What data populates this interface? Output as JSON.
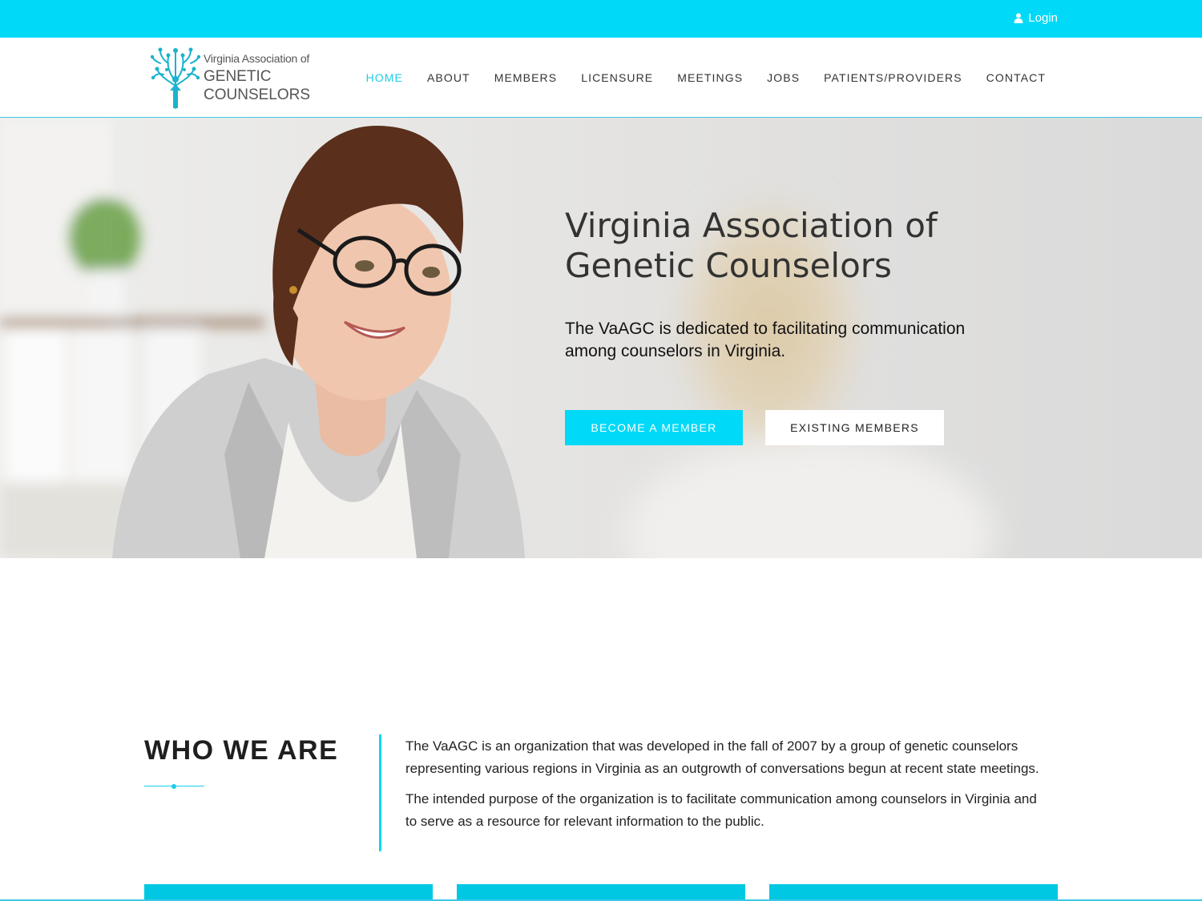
{
  "topbar": {
    "login_label": "Login",
    "accent_color": "#00d9f7"
  },
  "logo": {
    "line1": "Virginia Association of",
    "line2": "GENETIC",
    "line3": "COUNSELORS",
    "icon": "tree-person-icon"
  },
  "nav": {
    "items": [
      {
        "label": "HOME",
        "active": true
      },
      {
        "label": "ABOUT",
        "active": false
      },
      {
        "label": "MEMBERS",
        "active": false
      },
      {
        "label": "LICENSURE",
        "active": false
      },
      {
        "label": "MEETINGS",
        "active": false
      },
      {
        "label": "JOBS",
        "active": false
      },
      {
        "label": "PATIENTS/PROVIDERS",
        "active": false
      },
      {
        "label": "CONTACT",
        "active": false
      }
    ]
  },
  "hero": {
    "title_line1": "Virginia Association of",
    "title_line2": "Genetic Counselors",
    "subtitle": "The VaAGC is dedicated to facilitating communication among counselors in Virginia.",
    "primary_button": "BECOME A MEMBER",
    "secondary_button": "EXISTING MEMBERS"
  },
  "who": {
    "title": "WHO WE ARE",
    "paragraph1": "The VaAGC is an organization that was developed in the fall of 2007 by a group of genetic counselors representing various regions in Virginia as an outgrowth of conversations begun at recent state meetings.",
    "paragraph2": "The intended purpose of the organization is to facilitate communication among counselors in Virginia and to serve as a resource for relevant information to the public."
  }
}
